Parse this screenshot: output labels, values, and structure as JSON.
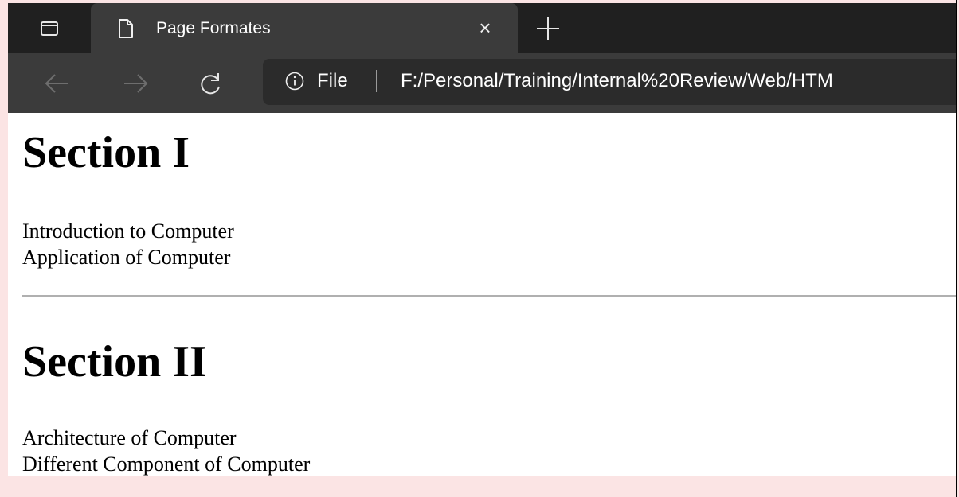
{
  "browser": {
    "tab": {
      "title": "Page Formates",
      "close_glyph": "×",
      "new_tab_glyph": "+"
    },
    "address_bar": {
      "scheme_label": "File",
      "url": "F:/Personal/Training/Internal%20Review/Web/HTM"
    },
    "icons": {
      "tab_actions": "tab-actions-icon",
      "page": "page-icon",
      "close": "close-icon",
      "new_tab": "plus-icon",
      "back": "back-arrow-icon",
      "forward": "forward-arrow-icon",
      "refresh": "refresh-icon",
      "info": "info-icon"
    }
  },
  "page": {
    "sections": [
      {
        "heading": "Section I",
        "items": [
          "Introduction to Computer",
          "Application of Computer"
        ]
      },
      {
        "heading": "Section II",
        "items": [
          "Architecture of Computer",
          "Different Component of Computer"
        ]
      }
    ]
  },
  "colors": {
    "tabstrip_bg": "#202020",
    "toolbar_bg": "#3b3b3b",
    "address_bg": "#2b2b2b",
    "page_bg": "#ffffff",
    "frame_bg": "#fbe4e4"
  }
}
